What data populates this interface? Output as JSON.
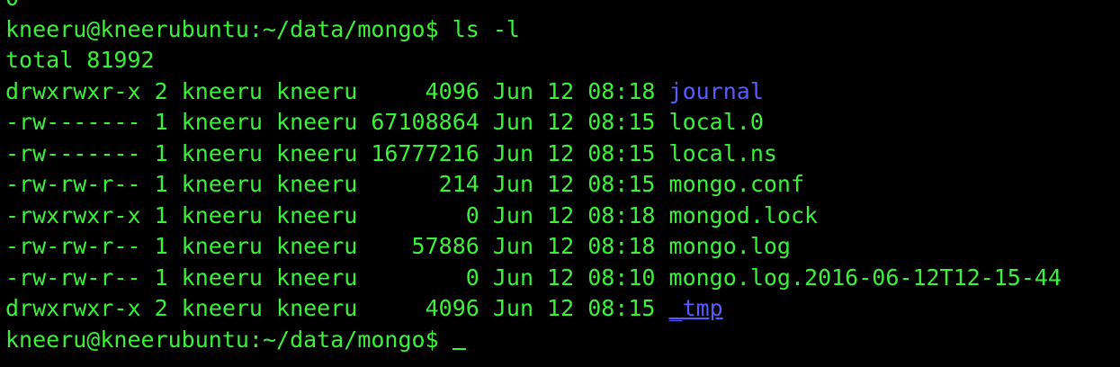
{
  "terminal": {
    "prev_output": "0",
    "prompt": "kneeru@kneerubuntu:~/data/mongo$",
    "command": "ls -l",
    "total": "total 81992",
    "entries": [
      {
        "prefix": "drwxrwxr-x 2 kneeru kneeru     4096 Jun 12 08:18 ",
        "name": "journal",
        "type": "dir"
      },
      {
        "prefix": "-rw------- 1 kneeru kneeru 67108864 Jun 12 08:15 ",
        "name": "local.0",
        "type": "file"
      },
      {
        "prefix": "-rw------- 1 kneeru kneeru 16777216 Jun 12 08:15 ",
        "name": "local.ns",
        "type": "file"
      },
      {
        "prefix": "-rw-rw-r-- 1 kneeru kneeru      214 Jun 12 08:15 ",
        "name": "mongo.conf",
        "type": "file"
      },
      {
        "prefix": "-rwxrwxr-x 1 kneeru kneeru        0 Jun 12 08:18 ",
        "name": "mongod.lock",
        "type": "file"
      },
      {
        "prefix": "-rw-rw-r-- 1 kneeru kneeru    57886 Jun 12 08:18 ",
        "name": "mongo.log",
        "type": "file"
      },
      {
        "prefix": "-rw-rw-r-- 1 kneeru kneeru        0 Jun 12 08:10 ",
        "name": "mongo.log.2016-06-12T12-15-44",
        "type": "file"
      },
      {
        "prefix": "drwxrwxr-x 2 kneeru kneeru     4096 Jun 12 08:15 ",
        "name": "_tmp",
        "type": "dir"
      }
    ],
    "colors": {
      "background": "#000000",
      "text": "#3cf03c",
      "directory": "#5a5aff"
    }
  }
}
